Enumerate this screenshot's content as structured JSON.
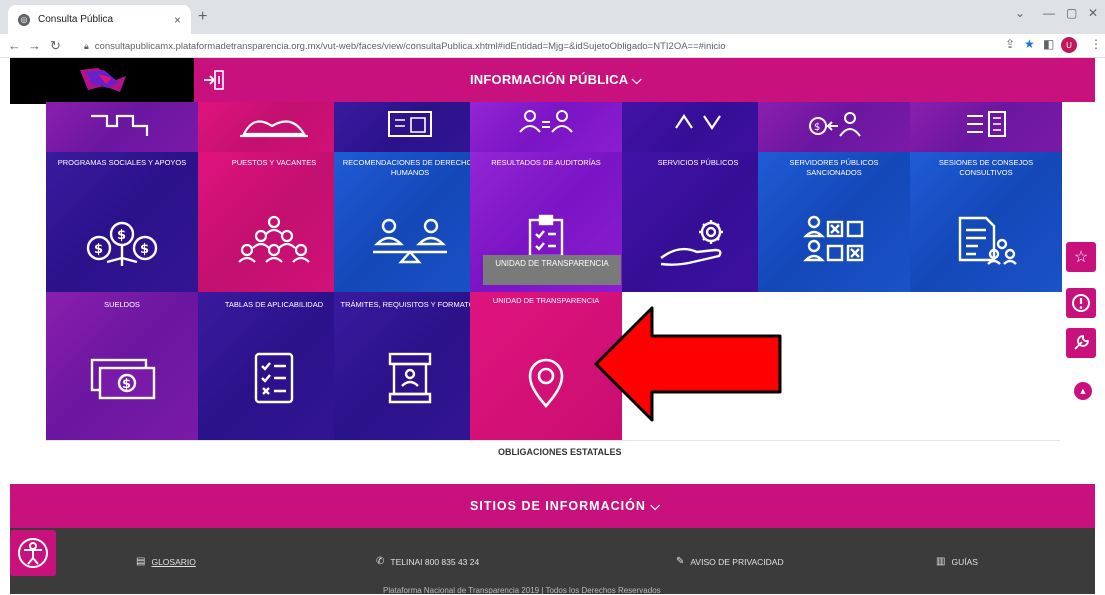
{
  "browser": {
    "tab_title": "Consulta Pública",
    "url": "consultapublicamx.plataformadetransparencia.org.mx/vut-web/faces/view/consultaPublica.xhtml#idEntidad=Mjg=&idSujetoObligado=NTI2OA==#inicio",
    "profile_initial": "U"
  },
  "header": {
    "title": "INFORMACIÓN PÚBLICA",
    "accent": "#c8117d"
  },
  "tiles_row0": [
    {
      "label": ""
    },
    {
      "label": ""
    },
    {
      "label": ""
    },
    {
      "label": ""
    },
    {
      "label": ""
    },
    {
      "label": ""
    },
    {
      "label": ""
    }
  ],
  "tiles_row1": [
    {
      "label": "PROGRAMAS SOCIALES Y APOYOS"
    },
    {
      "label": "PUESTOS Y VACANTES"
    },
    {
      "label": "RECOMENDACIONES DE DERECHOS HUMANOS"
    },
    {
      "label": "RESULTADOS DE AUDITORÍAS"
    },
    {
      "label": "SERVICIOS PÚBLICOS"
    },
    {
      "label": "SERVIDORES PÚBLICOS SANCIONADOS"
    },
    {
      "label": "SESIONES DE CONSEJOS CONSULTIVOS"
    }
  ],
  "tiles_row2": [
    {
      "label": "SUELDOS"
    },
    {
      "label": "TABLAS DE APLICABILIDAD"
    },
    {
      "label": "TRÁMITES, REQUISITOS Y FORMATOS"
    },
    {
      "label": "UNIDAD DE TRANSPARENCIA"
    }
  ],
  "tooltip": "UNIDAD DE TRANSPARENCIA",
  "obligaciones_label": "OBLIGACIONES ESTATALES",
  "sitios_title": "SITIOS DE INFORMACIÓN",
  "footer": {
    "glosario": "GLOSARIO",
    "telinai": "TELINAI 800 835 43 24",
    "aviso": "AVISO DE PRIVACIDAD",
    "guias": "GUÍAS",
    "copyright": "Plataforma Nacional de Transparencia 2019 | Todos los Derechos Reservados"
  }
}
